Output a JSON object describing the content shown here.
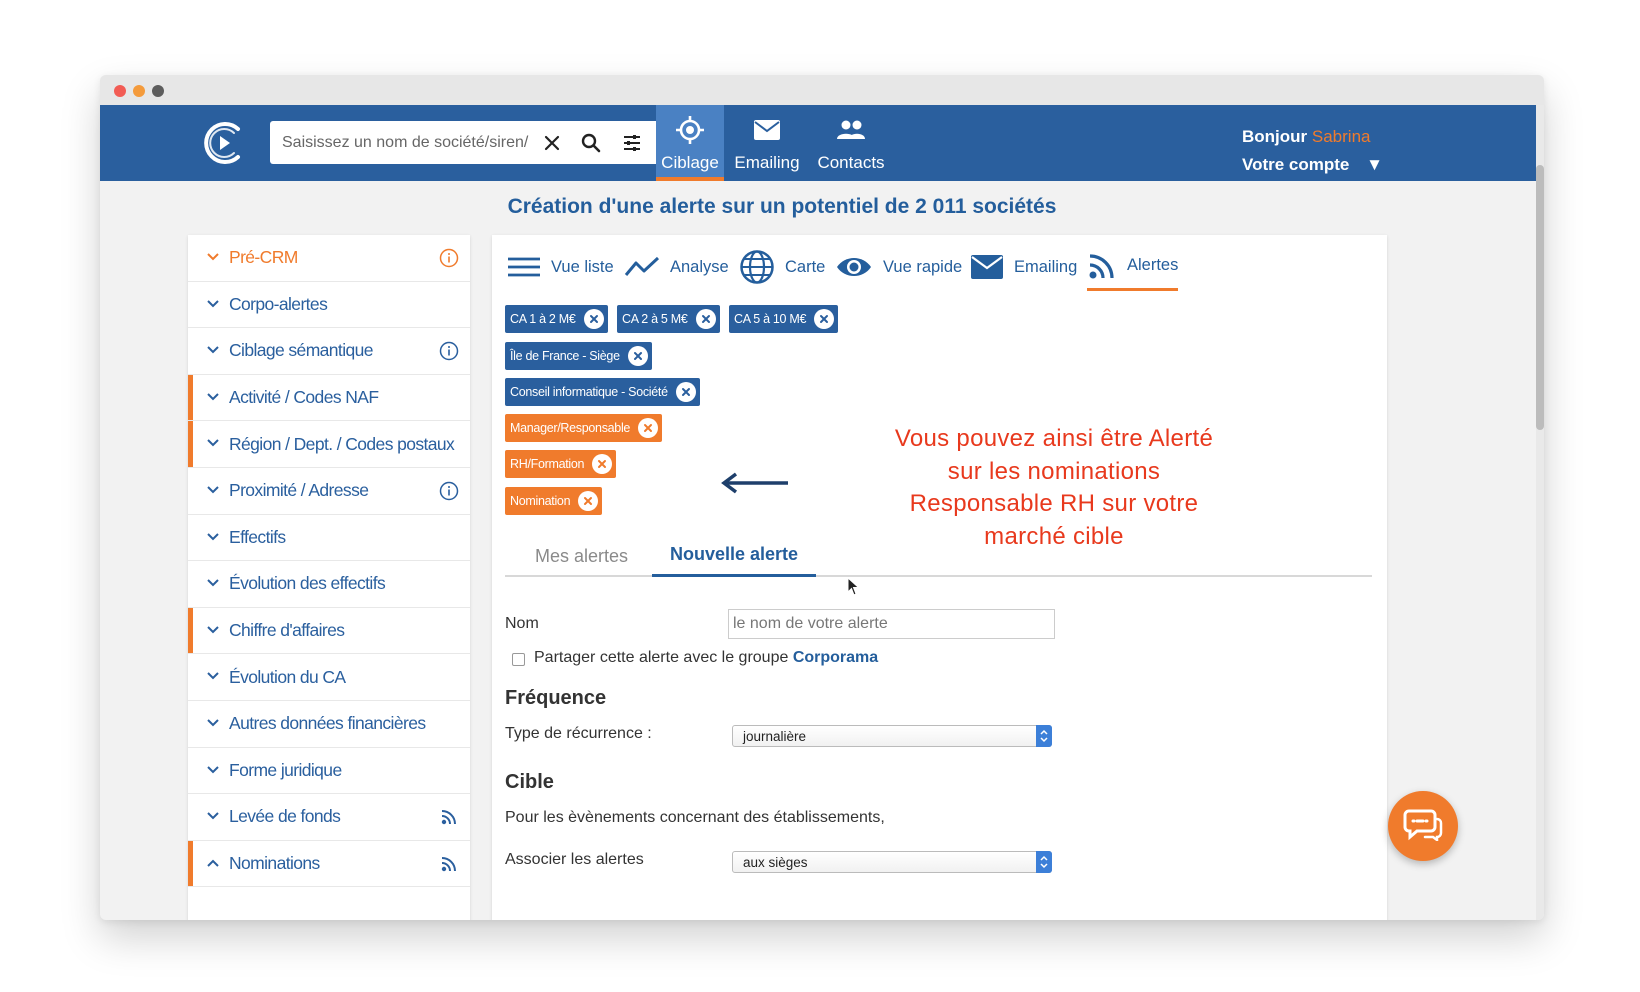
{
  "window": {
    "traffic_lights": [
      "close",
      "minimize",
      "zoom"
    ]
  },
  "header": {
    "logo": "corporama-logo-icon",
    "search": {
      "placeholder": "Saisissez un nom de société/siren/",
      "value": ""
    },
    "tabs": [
      {
        "label": "Ciblage",
        "icon": "target-icon",
        "active": true
      },
      {
        "label": "Emailing",
        "icon": "envelope-icon",
        "active": false
      },
      {
        "label": "Contacts",
        "icon": "people-icon",
        "active": false
      }
    ],
    "account": {
      "greeting": "Bonjour",
      "user": "Sabrina",
      "menu_label": "Votre compte",
      "caret": "▼"
    }
  },
  "page_title": "Création d'une alerte sur un potentiel de 2 011 sociétés",
  "sidebar": {
    "items": [
      {
        "label": "Pré-CRM",
        "expanded": false,
        "highlighted": true,
        "marked": false,
        "right_icon": "info-icon"
      },
      {
        "label": "Corpo-alertes",
        "expanded": false,
        "marked": false,
        "right_icon": ""
      },
      {
        "label": "Ciblage sémantique",
        "expanded": false,
        "marked": false,
        "right_icon": "info-icon"
      },
      {
        "label": "Activité / Codes NAF",
        "expanded": false,
        "marked": true,
        "right_icon": ""
      },
      {
        "label": "Région / Dept. / Codes postaux",
        "expanded": false,
        "marked": true,
        "right_icon": ""
      },
      {
        "label": "Proximité / Adresse",
        "expanded": false,
        "marked": false,
        "right_icon": "info-icon"
      },
      {
        "label": "Effectifs",
        "expanded": false,
        "marked": false,
        "right_icon": ""
      },
      {
        "label": "Évolution des effectifs",
        "expanded": false,
        "marked": false,
        "right_icon": ""
      },
      {
        "label": "Chiffre d'affaires",
        "expanded": false,
        "marked": true,
        "right_icon": ""
      },
      {
        "label": "Évolution du CA",
        "expanded": false,
        "marked": false,
        "right_icon": ""
      },
      {
        "label": "Autres données financières",
        "expanded": false,
        "marked": false,
        "right_icon": ""
      },
      {
        "label": "Forme juridique",
        "expanded": false,
        "marked": false,
        "right_icon": ""
      },
      {
        "label": "Levée de fonds",
        "expanded": false,
        "marked": false,
        "right_icon": "rss-icon"
      },
      {
        "label": "Nominations",
        "expanded": true,
        "marked": true,
        "right_icon": "rss-icon"
      }
    ]
  },
  "view_tabs": [
    {
      "label": "Vue liste",
      "icon": "list-icon",
      "active": false
    },
    {
      "label": "Analyse",
      "icon": "trend-line-icon",
      "active": false
    },
    {
      "label": "Carte",
      "icon": "globe-icon",
      "active": false
    },
    {
      "label": "Vue rapide",
      "icon": "eye-icon",
      "active": false
    },
    {
      "label": "Emailing",
      "icon": "envelope-icon",
      "active": false
    },
    {
      "label": "Alertes",
      "icon": "rss-icon",
      "active": true
    }
  ],
  "filters": [
    {
      "label": "CA 1 à 2 M€",
      "color": "blue"
    },
    {
      "label": "CA 2 à 5 M€",
      "color": "blue"
    },
    {
      "label": "CA 5 à 10 M€",
      "color": "blue"
    },
    {
      "label": "Île de France - Siège",
      "color": "blue"
    },
    {
      "label": "Conseil informatique - Société",
      "color": "blue"
    },
    {
      "label": "Manager/Responsable",
      "color": "orange"
    },
    {
      "label": "RH/Formation",
      "color": "orange"
    },
    {
      "label": "Nomination",
      "color": "orange"
    }
  ],
  "annotation": {
    "lines": [
      "Vous pouvez ainsi être Alerté",
      "sur les nominations",
      "Responsable RH sur votre",
      "marché cible"
    ],
    "color": "#e8391d"
  },
  "alert_tabs": [
    {
      "label": "Mes alertes",
      "active": false
    },
    {
      "label": "Nouvelle alerte",
      "active": true
    }
  ],
  "form": {
    "name_label": "Nom",
    "name_placeholder": "le nom de votre alerte",
    "name_value": "",
    "share": {
      "checked": false,
      "prefix": "Partager cette alerte avec le groupe",
      "group": "Corporama"
    },
    "frequency_title": "Fréquence",
    "recurrence_label": "Type de récurrence :",
    "recurrence_value": "journalière",
    "target_title": "Cible",
    "target_text": "Pour les èvènements concernant des établissements,",
    "associate_label": "Associer les alertes",
    "associate_value": "aux sièges"
  },
  "chat": {
    "icon": "chat-bubbles-icon"
  },
  "colors": {
    "brand_blue": "#2a5f9e",
    "accent_orange": "#f07b2c",
    "callout_red": "#e8391d"
  }
}
